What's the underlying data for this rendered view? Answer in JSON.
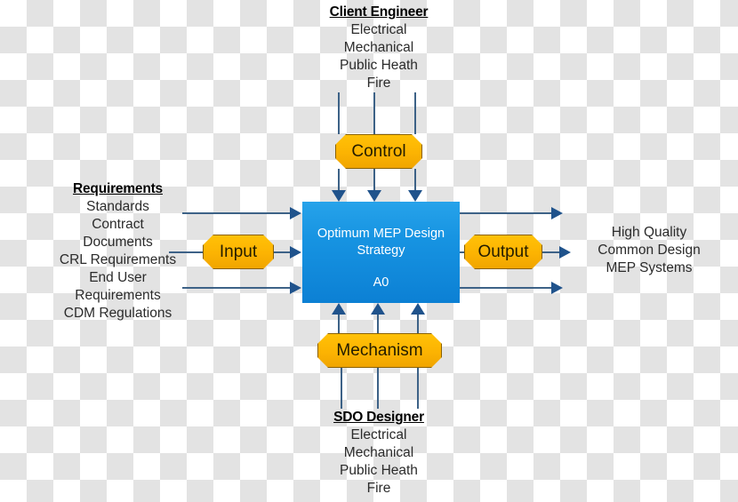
{
  "diagram": {
    "title": "Optimum MEP Design Strategy IDEF0",
    "type": "idef0",
    "colors": {
      "box_fill_top": "#27a3ea",
      "box_fill_bottom": "#0c80d4",
      "callout_fill": "#fcb302",
      "callout_border": "#8a6100",
      "arrow": "#20538c",
      "line": "#3d6287",
      "text": "#2b2b2b"
    }
  },
  "activity": {
    "title_line1": "Optimum MEP Design",
    "title_line2": "Strategy",
    "code": "A0"
  },
  "callouts": {
    "control": "Control",
    "mechanism": "Mechanism",
    "input": "Input",
    "output": "Output"
  },
  "top_actor": {
    "heading": "Client Engineer",
    "items": [
      "Electrical",
      "Mechanical",
      "Public Heath",
      "Fire"
    ]
  },
  "bottom_actor": {
    "heading": "SDO Designer",
    "items": [
      "Electrical",
      "Mechanical",
      "Public Heath",
      "Fire"
    ]
  },
  "left_inputs": {
    "heading": "Requirements",
    "items": [
      "Standards",
      "Contract",
      "Documents",
      "CRL Requirements",
      "End User",
      "Requirements",
      "CDM Regulations"
    ]
  },
  "right_outputs": {
    "items": [
      "High Quality",
      "Common Design",
      "MEP Systems"
    ]
  }
}
